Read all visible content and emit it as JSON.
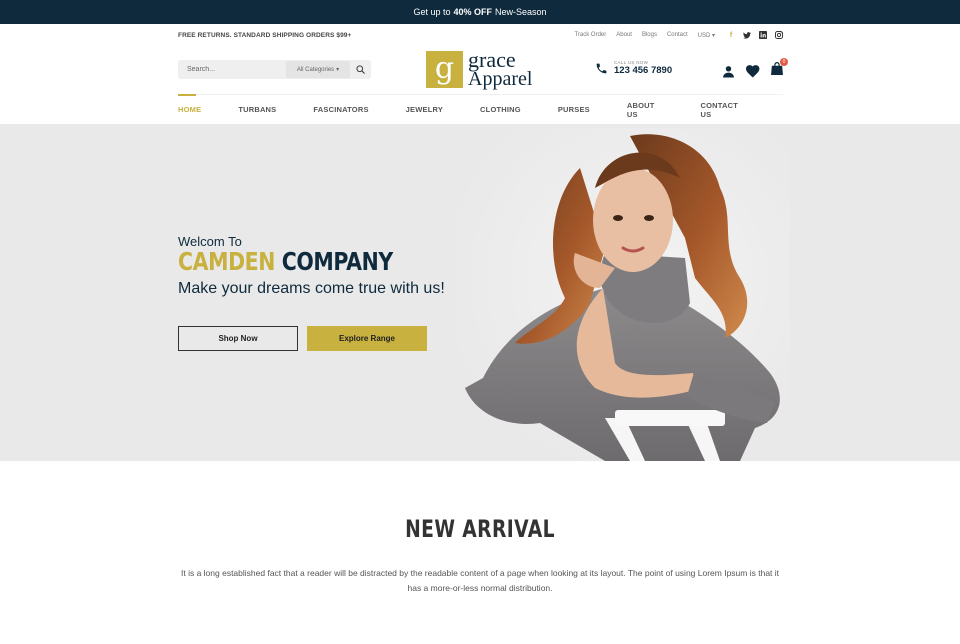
{
  "promo": {
    "prefix": "Get up to",
    "highlight": "40% OFF",
    "suffix": "New-Season"
  },
  "utility": {
    "shipping_note": "FREE RETURNS. STANDARD SHIPPING ORDERS $99+",
    "links": [
      "Track Order",
      "About",
      "Blogs",
      "Contact"
    ],
    "currency": "USD",
    "social_icons": [
      "facebook-icon",
      "twitter-icon",
      "linkedin-icon",
      "instagram-icon"
    ]
  },
  "search": {
    "placeholder": "Search...",
    "category": "All Categories"
  },
  "logo": {
    "mark": "g",
    "line1": "grace",
    "line2": "Apparel"
  },
  "contact": {
    "label": "CALL US NOW",
    "number": "123 456 7890"
  },
  "cart": {
    "count": "0"
  },
  "nav": {
    "items": [
      "HOME",
      "TURBANS",
      "FASCINATORS",
      "JEWELRY",
      "CLOTHING",
      "PURSES",
      "ABOUT US",
      "CONTACT US"
    ],
    "active": "HOME"
  },
  "hero": {
    "welcome": "Welcom To",
    "company_part1": "CAMDEN",
    "company_part2": "COMPANY",
    "tagline": "Make your dreams come true with us!",
    "btn_primary": "Shop Now",
    "btn_secondary": "Explore Range"
  },
  "new_arrival": {
    "title": "NEW ARRIVAL",
    "description": "It is a long established fact that a reader will be distracted by the readable content of a page when looking at its layout. The point of using Lorem Ipsum is that it has a more-or-less normal distribution."
  },
  "colors": {
    "navy": "#0f2a3c",
    "gold": "#c8b13f",
    "badge": "#e15a43"
  }
}
